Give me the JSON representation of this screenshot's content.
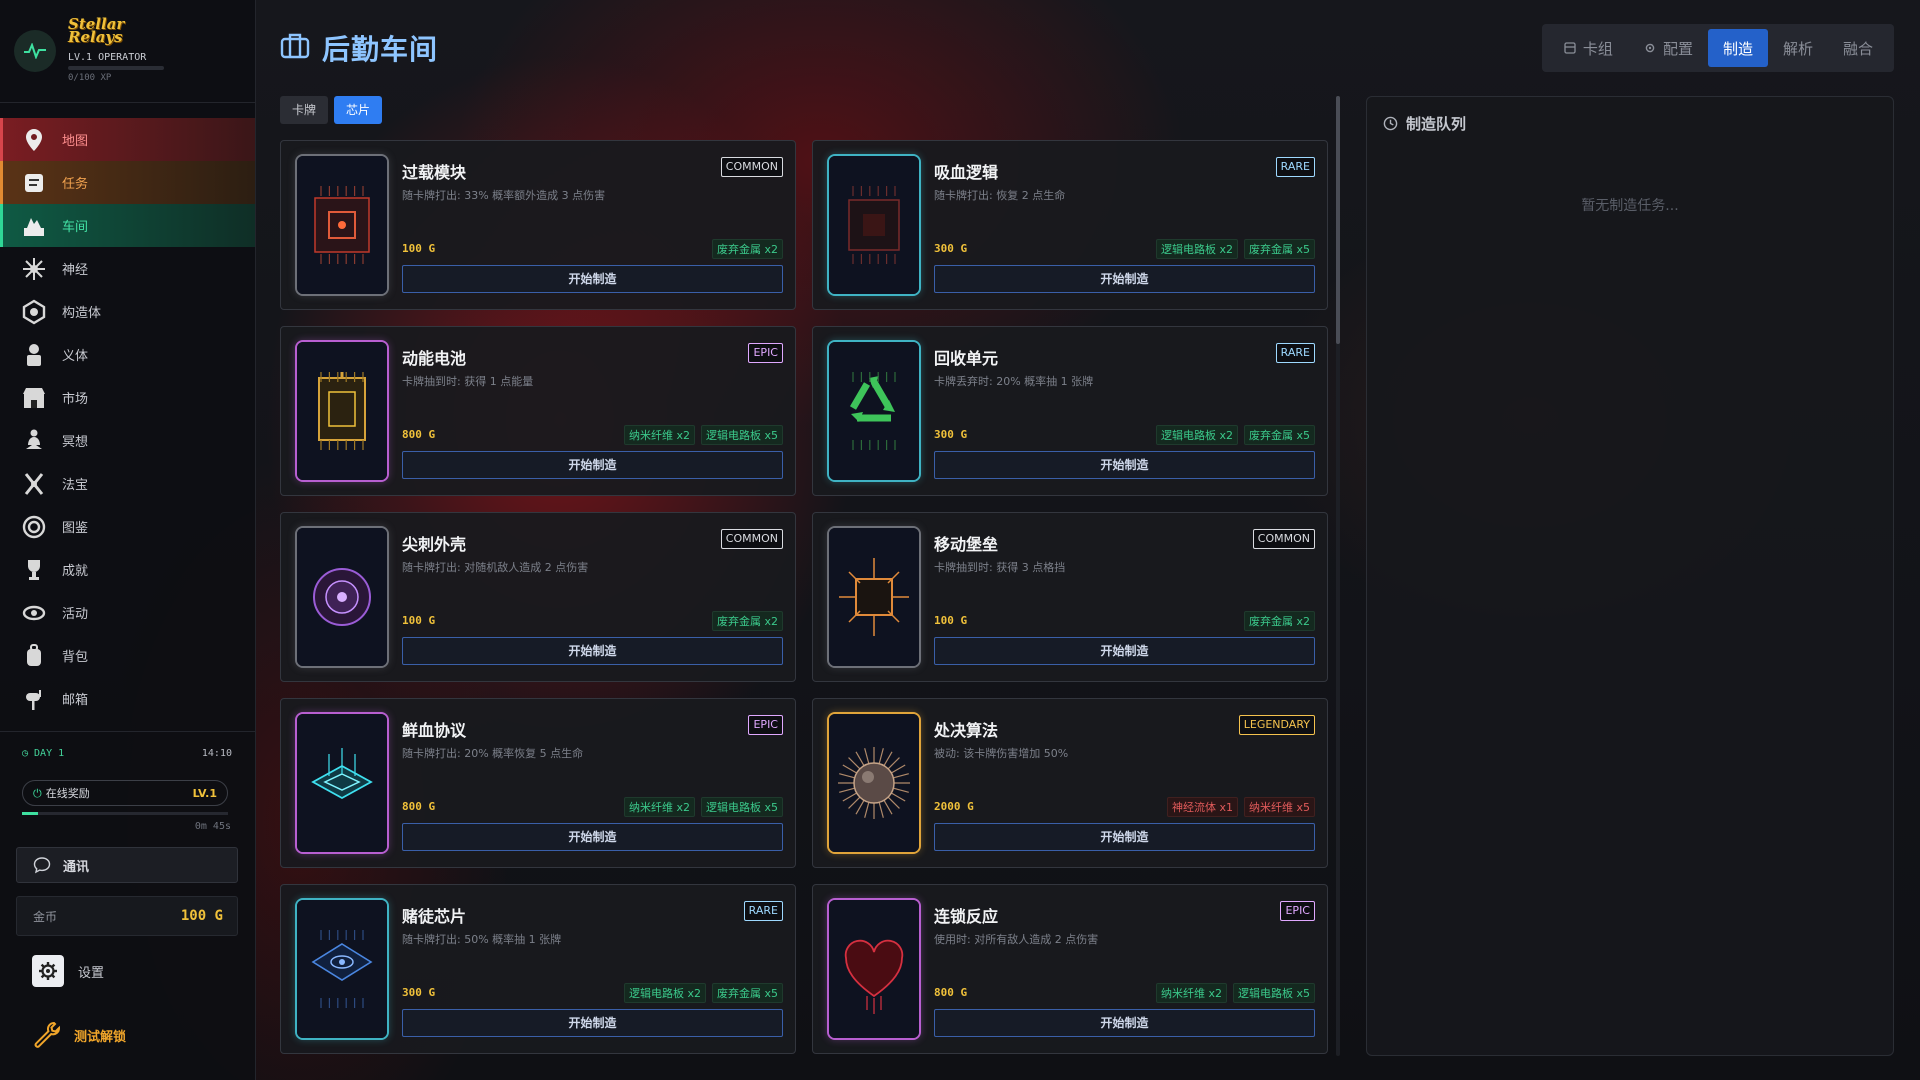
{
  "brand": {
    "logo_line1": "Stellar",
    "logo_line2": "Relays",
    "level": "LV.1 OPERATOR",
    "xp": "0/100 XP"
  },
  "nav": [
    {
      "label": "地图",
      "icon": "map-pin-icon",
      "state": "active-map"
    },
    {
      "label": "任务",
      "icon": "quest-scroll-icon",
      "state": "active-task"
    },
    {
      "label": "车间",
      "icon": "workshop-icon",
      "state": "active-work"
    },
    {
      "label": "神经",
      "icon": "neuron-icon",
      "state": ""
    },
    {
      "label": "构造体",
      "icon": "construct-icon",
      "state": ""
    },
    {
      "label": "义体",
      "icon": "cyborg-icon",
      "state": ""
    },
    {
      "label": "市场",
      "icon": "market-icon",
      "state": ""
    },
    {
      "label": "冥想",
      "icon": "meditate-icon",
      "state": ""
    },
    {
      "label": "法宝",
      "icon": "artifact-icon",
      "state": ""
    },
    {
      "label": "图鉴",
      "icon": "codex-icon",
      "state": ""
    },
    {
      "label": "成就",
      "icon": "trophy-icon",
      "state": ""
    },
    {
      "label": "活动",
      "icon": "event-eye-icon",
      "state": ""
    },
    {
      "label": "背包",
      "icon": "backpack-icon",
      "state": ""
    },
    {
      "label": "邮箱",
      "icon": "mailbox-icon",
      "state": ""
    }
  ],
  "status": {
    "day": "DAY 1",
    "time": "14:10",
    "online_reward": "在线奖励",
    "online_level": "LV.1",
    "online_progress": 0.08,
    "online_timer": "0m 45s"
  },
  "comm_label": "通讯",
  "coins": {
    "label": "金币",
    "value": "100 G"
  },
  "settings_label": "设置",
  "unlock_label": "测试解锁",
  "page_title": "后勤车间",
  "sub_tabs": [
    {
      "label": "卡牌",
      "active": false
    },
    {
      "label": "芯片",
      "active": true
    }
  ],
  "top_tabs": [
    {
      "label": "卡组",
      "icon": "deck-icon",
      "active": false
    },
    {
      "label": "配置",
      "icon": "gear-icon",
      "active": false
    },
    {
      "label": "制造",
      "icon": "",
      "active": true
    },
    {
      "label": "解析",
      "icon": "",
      "active": false
    },
    {
      "label": "融合",
      "icon": "",
      "active": false
    }
  ],
  "build_label": "开始制造",
  "chips": [
    {
      "name": "过载模块",
      "rarity": "COMMON",
      "desc": "随卡牌打出: 33% 概率额外造成 3 点伤害",
      "price": "100 G",
      "materials": [
        {
          "text": "废弃金属 x2",
          "ok": true
        }
      ],
      "art": "chip-red",
      "border": "#6d7078"
    },
    {
      "name": "吸血逻辑",
      "rarity": "RARE",
      "desc": "随卡牌打出: 恢复 2 点生命",
      "price": "300 G",
      "materials": [
        {
          "text": "逻辑电路板 x2",
          "ok": true
        },
        {
          "text": "废弃金属 x5",
          "ok": true
        }
      ],
      "art": "chip-dark",
      "border": "#3fb3c4"
    },
    {
      "name": "动能电池",
      "rarity": "EPIC",
      "desc": "卡牌抽到时: 获得 1 点能量",
      "price": "800 G",
      "materials": [
        {
          "text": "纳米纤维 x2",
          "ok": true
        },
        {
          "text": "逻辑电路板 x5",
          "ok": true
        }
      ],
      "art": "battery-gold",
      "border": "#b85fd1"
    },
    {
      "name": "回收单元",
      "rarity": "RARE",
      "desc": "卡牌丢弃时: 20% 概率抽 1 张牌",
      "price": "300 G",
      "materials": [
        {
          "text": "逻辑电路板 x2",
          "ok": true
        },
        {
          "text": "废弃金属 x5",
          "ok": true
        }
      ],
      "art": "recycle-green",
      "border": "#3fb3c4"
    },
    {
      "name": "尖刺外壳",
      "rarity": "COMMON",
      "desc": "随卡牌打出: 对随机敌人造成 2 点伤害",
      "price": "100 G",
      "materials": [
        {
          "text": "废弃金属 x2",
          "ok": true
        }
      ],
      "art": "spike-purple",
      "border": "#6d7078"
    },
    {
      "name": "移动堡垒",
      "rarity": "COMMON",
      "desc": "卡牌抽到时: 获得 3 点格挡",
      "price": "100 G",
      "materials": [
        {
          "text": "废弃金属 x2",
          "ok": true
        }
      ],
      "art": "chip-orange",
      "border": "#6d7078"
    },
    {
      "name": "鲜血协议",
      "rarity": "EPIC",
      "desc": "随卡牌打出: 20% 概率恢复 5 点生命",
      "price": "800 G",
      "materials": [
        {
          "text": "纳米纤维 x2",
          "ok": true
        },
        {
          "text": "逻辑电路板 x5",
          "ok": true
        }
      ],
      "art": "holo-cyan",
      "border": "#b85fd1"
    },
    {
      "name": "处决算法",
      "rarity": "LEGENDARY",
      "desc": "被动: 该卡牌伤害增加 50%",
      "price": "2000 G",
      "materials": [
        {
          "text": "神经流体 x1",
          "ok": false
        },
        {
          "text": "纳米纤维 x5",
          "ok": false
        }
      ],
      "art": "sphere-spike",
      "border": "#e0a43a"
    },
    {
      "name": "赌徒芯片",
      "rarity": "RARE",
      "desc": "随卡牌打出: 50% 概率抽 1 张牌",
      "price": "300 G",
      "materials": [
        {
          "text": "逻辑电路板 x2",
          "ok": true
        },
        {
          "text": "废弃金属 x5",
          "ok": true
        }
      ],
      "art": "chip-blue",
      "border": "#3fb3c4"
    },
    {
      "name": "连锁反应",
      "rarity": "EPIC",
      "desc": "使用时: 对所有敌人造成 2 点伤害",
      "price": "800 G",
      "materials": [
        {
          "text": "纳米纤维 x2",
          "ok": true
        },
        {
          "text": "逻辑电路板 x5",
          "ok": true
        }
      ],
      "art": "heart-red",
      "border": "#b85fd1"
    }
  ],
  "rarity_colors": {
    "COMMON": "#d9dbe0",
    "RARE": "#9ed9ff",
    "EPIC": "#e0a8ff",
    "LEGENDARY": "#f4c24e"
  },
  "queue": {
    "title": "制造队列",
    "empty_text": "暂无制造任务..."
  }
}
